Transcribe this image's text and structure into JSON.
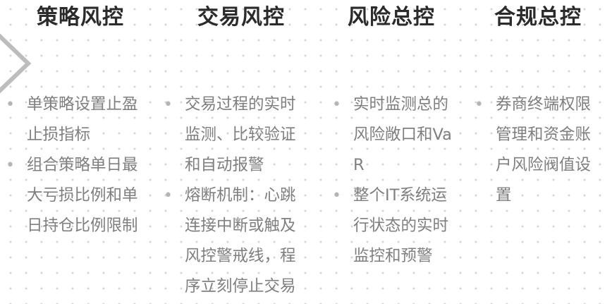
{
  "columns": [
    {
      "title": "策略风控",
      "items": [
        "单策略设置止盈止损指标",
        "组合策略单日最大亏损比例和单日持仓比例限制"
      ]
    },
    {
      "title": "交易风控",
      "items": [
        "交易过程的实时监测、比较验证和自动报警",
        "熔断机制：心跳连接中断或触及风控警戒线，程序立刻停止交易"
      ]
    },
    {
      "title": "风险总控",
      "items": [
        "实时监测总的风险敞口和VaR",
        "整个IT系统运行状态的实时监控和预警"
      ]
    },
    {
      "title": "合规总控",
      "items": [
        "券商终端权限管理和资金账户风险阀值设置"
      ]
    }
  ],
  "bullet_glyph": "•",
  "colors": {
    "title": "#2b2b2b",
    "text": "#7f7f7f",
    "bullet": "#b5b5b5",
    "chevron": "#bdbdbd",
    "dots": "#d3d3d3"
  }
}
